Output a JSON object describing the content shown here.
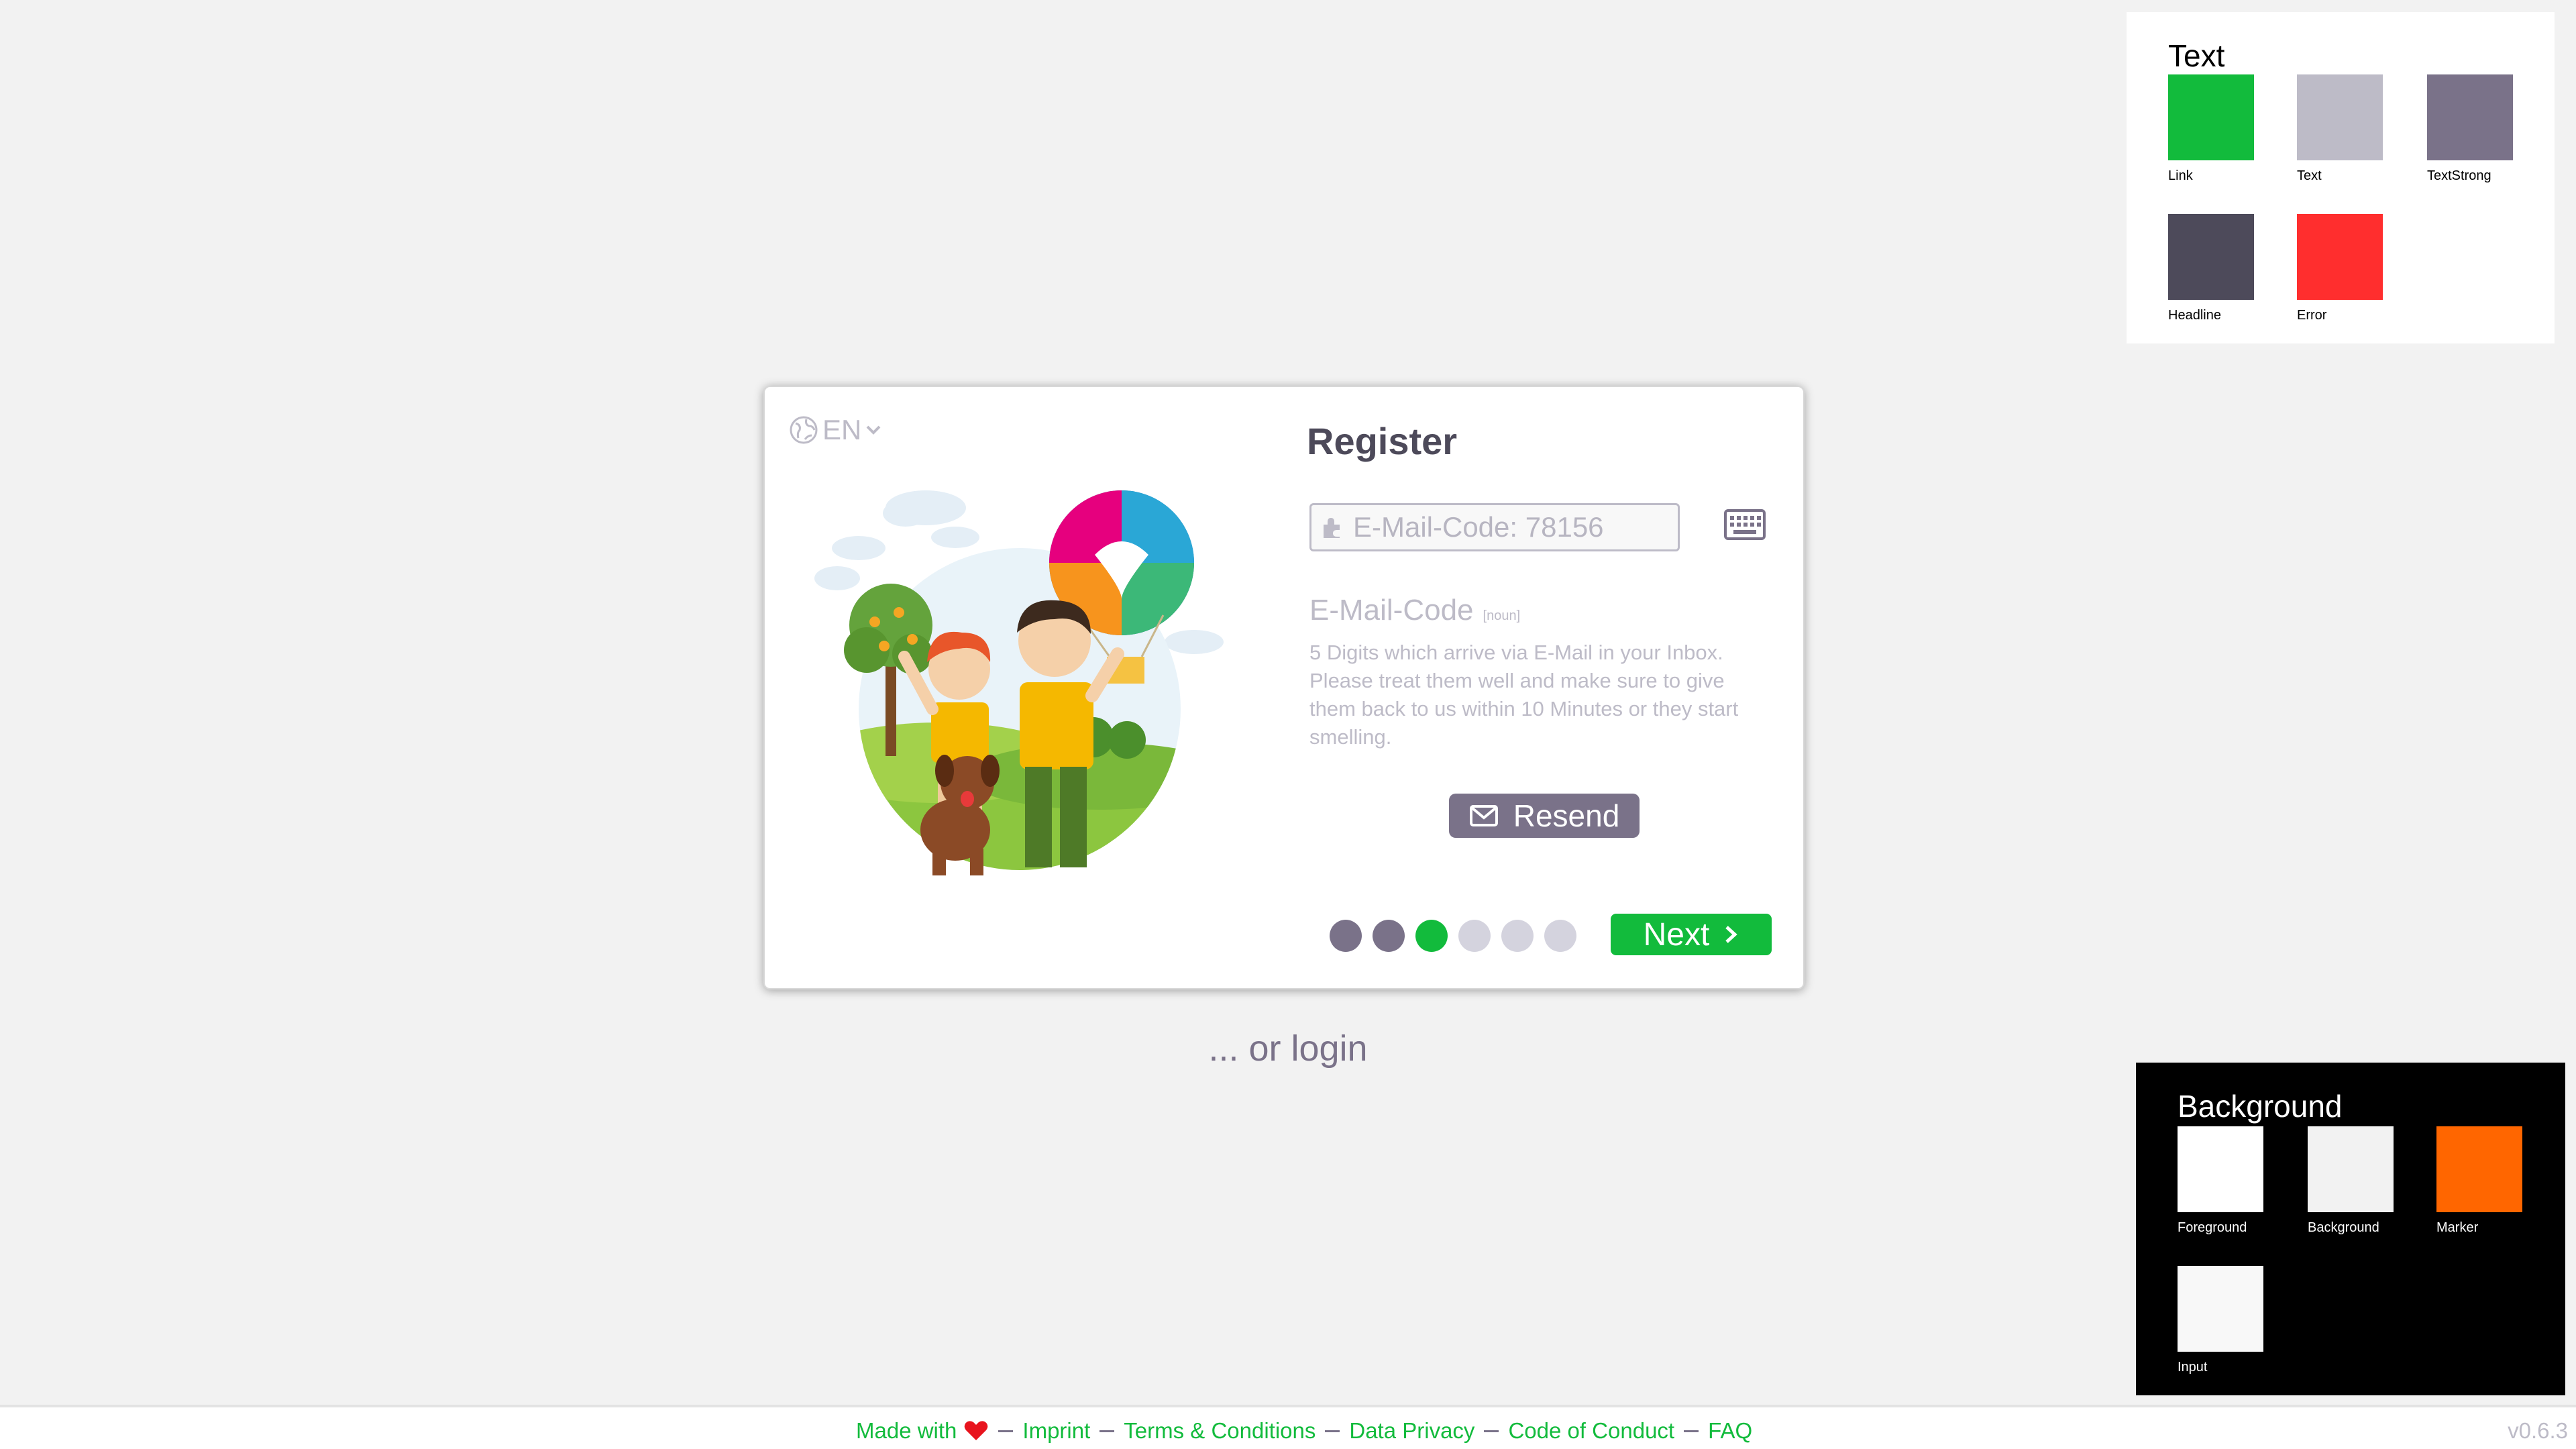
{
  "language": {
    "label": "EN",
    "icon": "globe-icon"
  },
  "register": {
    "title": "Register",
    "email_code_placeholder": "E-Mail-Code: 78156",
    "email_code_value": "",
    "dictionary": {
      "term": "E-Mail-Code",
      "type": "[noun]",
      "definition": "5 Digits which arrive via E-Mail in your Inbox. Please treat them well and make sure to give them back to us within 10 Minutes or they start smelling."
    },
    "resend_label": "Resend",
    "next_label": "Next",
    "progress": {
      "total": 6,
      "completed": 2,
      "current": 3
    }
  },
  "or_login": "... or login",
  "palette_text": {
    "title": "Text",
    "swatches": [
      {
        "label": "Link",
        "color": "#12bb3c"
      },
      {
        "label": "Text",
        "color": "#bdbbc7"
      },
      {
        "label": "TextStrong",
        "color": "#7a7289"
      },
      {
        "label": "Headline",
        "color": "#4d4a5a"
      },
      {
        "label": "Error",
        "color": "#ff2e2e"
      }
    ]
  },
  "palette_background": {
    "title": "Background",
    "swatches": [
      {
        "label": "Foreground",
        "color": "#ffffff"
      },
      {
        "label": "Background",
        "color": "#f2f2f2"
      },
      {
        "label": "Marker",
        "color": "#ff6600"
      },
      {
        "label": "Input",
        "color": "#f8f8f8"
      }
    ]
  },
  "footer": {
    "links": [
      {
        "label": "Made with",
        "icon": "heart-icon"
      },
      {
        "label": "Imprint"
      },
      {
        "label": "Terms & Conditions"
      },
      {
        "label": "Data Privacy"
      },
      {
        "label": "Code of Conduct"
      },
      {
        "label": "FAQ"
      }
    ],
    "version": "v0.6.3"
  },
  "colors": {
    "accent": "#12bb3c",
    "strong": "#7a7289",
    "text": "#bdbbc7",
    "headline": "#4d4a5a",
    "dot_inactive": "#d4d3de"
  }
}
